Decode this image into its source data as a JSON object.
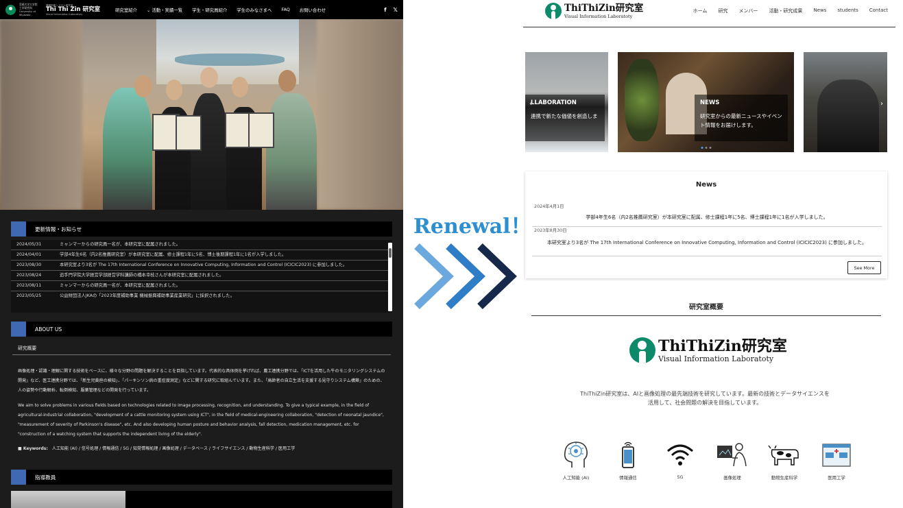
{
  "renewal": {
    "label": "Renewal！"
  },
  "old_site": {
    "nav": {
      "university": [
        "宮崎大学大学院",
        "工学研究科",
        "University of Miyazaki"
      ],
      "lab_small_top": "情報知能システム研究室",
      "lab_name": "Thi Thi Zin 研究室",
      "lab_small_bottom": "Visual Information Laboratory",
      "menu": [
        "研究室紹介",
        "⌄ 活動・実績一覧",
        "学生・研究員紹介",
        "学生のみなさまへ",
        "FAQ",
        "お問い合わせ"
      ],
      "social": [
        "f",
        "𝕏"
      ]
    },
    "news_section": {
      "label": "更新情報・お知らせ",
      "items": [
        {
          "date": "2024/05/31",
          "text": "ミャンマーからの研究員一名が、本研究室に配属されました。"
        },
        {
          "date": "2024/04/01",
          "text": "学部4年生6名（内2名推薦研究室）が本研究室に配属、修士課程1年に5名、博士後期課程1年に1名が入学しました。"
        },
        {
          "date": "2023/08/30",
          "text": "本研究室より3名が The 17th International Conference on Innovative Computing, Information and Control (ICICIC2023) に参加しました。"
        },
        {
          "date": "2023/08/24",
          "text": "追手門学院大学経営学部経営学科講師の橋本幸枝さんが本研究室に配属されました。"
        },
        {
          "date": "2023/08/11",
          "text": "ミャンマーからの研究員一名が、本研究室に配属されました。"
        },
        {
          "date": "2023/05/25",
          "text": "公益財団法人JKAの「2023年度補助事業 機械振興補助事業産業研究」に採択されました。"
        }
      ]
    },
    "about": {
      "label": "ABOUT US",
      "subtitle": "研究概要",
      "paragraph_jp": "画像処理・認識・理解に関する技術をベースに、様々な分野の問題を解決することを目指しています。代表的な具体例を挙げれば、農工連携分野では、「ICTを活用した牛のモニタリングシステムの開発」など、医工連携分野では、「新生児黄疸の検知」、「パーキンソン病の重症度測定」などに関する研究に取組んでいます。また、「高齢者の自立生活を支援する見守りシステム構築」のための、人の姿勢や行動解析、転倒検知、服薬管理などの開発を行っています。",
      "paragraph_en": "We aim to solve problems in various fields based on technologies related to image processing, recognition, and understanding. To give a typical example, in the field of agricultural-industrial collaboration, \"development of a cattle monitoring system using ICT\", in the field of medical-engineering collaboration, \"detection of neonatal jaundice\", \"measurement of severity of Parkinson's disease\", etc. And also developing human posture and behavior analysis, fall detection, medication management, etc. for \"construction of a watching system that supports the independent living of the elderly\".",
      "keywords_label": "■ Keywords:",
      "keywords": "人工知能 (AI) / 信号処理 / 情報通信 / 5G / 知覚情報処理 / 画像処理 / データベース / ライフサイエンス / 動物生産科学 / 医用工学"
    },
    "faculty": {
      "label": "指導教員"
    }
  },
  "new_site": {
    "logo": {
      "name": "ThiThiZin研究室",
      "sub": "Visual Information Laboratoty"
    },
    "menu": [
      "ホーム",
      "研究",
      "メンバー",
      "活動・研究成果",
      "News",
      "students",
      "Contact"
    ],
    "carousel": [
      {
        "title": "LLABORATION",
        "text": "連携で新たな価値を創造しま"
      },
      {
        "title": "NEWS",
        "text": "研究室からの最新ニュースやイベント情報をお届けします。"
      },
      {
        "title": "",
        "text": ""
      }
    ],
    "news": {
      "title": "News",
      "items": [
        {
          "date": "2024年4月1日",
          "text": "学部4年生6名（内2名推薦研究室）が本研究室に配属、修士課程1年に5名、博士課程1年に1名が入学しました。"
        },
        {
          "date": "2023年8月30日",
          "text": "本研究室より3名が The 17th International Conference on Innovative Computing, Information and Control (ICICIC2023) に参加しました。"
        }
      ],
      "see_more": "See More"
    },
    "overview": {
      "title": "研究室概要",
      "logo_name": "ThiThiZin研究室",
      "logo_sub": "Visual Information Laboratoty",
      "intro": "ThiThiZin研究室は、AIと画像処理の最先端技術を研究しています。最新の技術とデータサイエンスを活用して、社会問題の解決を目指しています。",
      "fields": [
        {
          "icon": "brain-ai-icon",
          "label": "人工知能 (AI)"
        },
        {
          "icon": "smartphone-icon",
          "label": "情報通信"
        },
        {
          "icon": "wifi-signal-icon",
          "label": "5G"
        },
        {
          "icon": "image-processing-icon",
          "label": "画像処理"
        },
        {
          "icon": "cow-icon",
          "label": "動物生産科学"
        },
        {
          "icon": "hospital-icon",
          "label": "医用工学"
        }
      ]
    }
  },
  "colors": {
    "old_accent": "#3f69b3",
    "renewal_blue": "#2e8fd0",
    "logo_green": "#0d8a6a"
  }
}
